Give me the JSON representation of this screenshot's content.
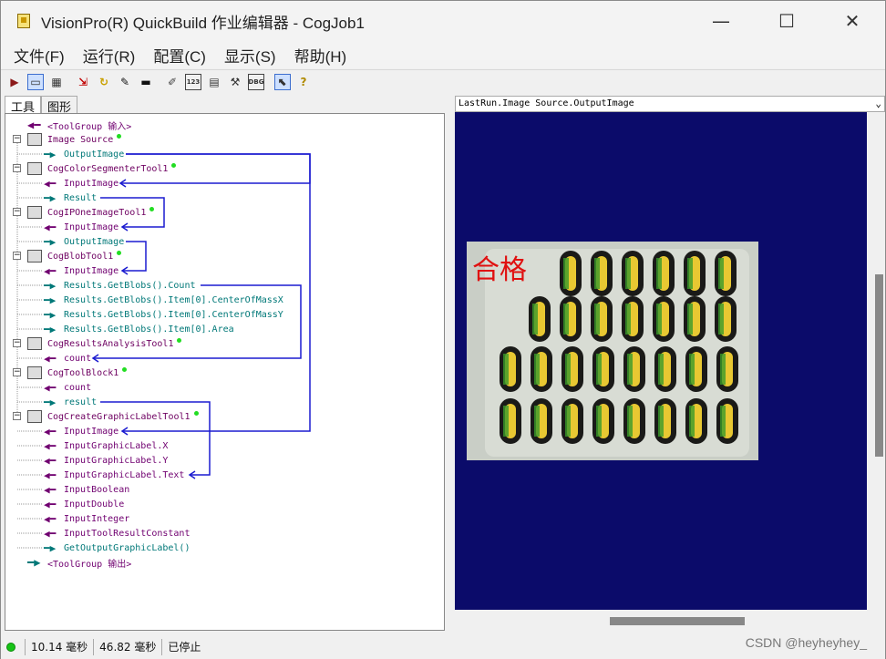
{
  "window": {
    "title": "VisionPro(R) QuickBuild 作业编辑器 - CogJob1",
    "controls": {
      "minimize": "—",
      "maximize": "☐",
      "close": "✕"
    }
  },
  "menu": [
    "文件(F)",
    "运行(R)",
    "配置(C)",
    "显示(S)",
    "帮助(H)"
  ],
  "toolbar": {
    "buttons": [
      {
        "name": "run-icon",
        "glyph": "▶",
        "color": "#8b1a1a"
      },
      {
        "name": "show-tools-icon",
        "glyph": "▭",
        "color": "#333",
        "selected": true
      },
      {
        "name": "show-image-icon",
        "glyph": "▦",
        "color": "#333"
      },
      {
        "name": "add-link-icon",
        "glyph": "⇲",
        "color": "#c00000"
      },
      {
        "name": "refresh-icon",
        "glyph": "↻",
        "color": "#c9a000"
      },
      {
        "name": "brush-icon",
        "glyph": "✎",
        "color": "#111"
      },
      {
        "name": "plug-icon",
        "glyph": "▬",
        "color": "#111"
      },
      {
        "name": "notes-icon",
        "glyph": "✐",
        "color": "#444"
      },
      {
        "name": "numbers-icon",
        "glyph": "123",
        "color": "#333"
      },
      {
        "name": "table-icon",
        "glyph": "▤",
        "color": "#333"
      },
      {
        "name": "tools-icon",
        "glyph": "⚒",
        "color": "#333"
      },
      {
        "name": "debug-icon",
        "glyph": "DBG",
        "color": "#333"
      },
      {
        "name": "pointer-icon",
        "glyph": "⬉",
        "color": "#333",
        "selected": true
      },
      {
        "name": "help-icon",
        "glyph": "?",
        "color": "#b08a00"
      }
    ]
  },
  "tabs": [
    "工具",
    "图形"
  ],
  "tree": {
    "rows": [
      {
        "text": "<ToolGroup 输入>",
        "kind": "group-in"
      },
      {
        "text": "Image Source",
        "kind": "tool",
        "icon": "camera",
        "dot": true
      },
      {
        "text": "OutputImage",
        "kind": "out"
      },
      {
        "text": "CogColorSegmenterTool1",
        "kind": "tool",
        "icon": "color-segmenter",
        "dot": true
      },
      {
        "text": "InputImage",
        "kind": "in"
      },
      {
        "text": "Result",
        "kind": "out"
      },
      {
        "text": "CogIPOneImageTool1",
        "kind": "tool",
        "icon": "ipone",
        "dot": true
      },
      {
        "text": "InputImage",
        "kind": "in"
      },
      {
        "text": "OutputImage",
        "kind": "out"
      },
      {
        "text": "CogBlobTool1",
        "kind": "tool",
        "icon": "blob",
        "dot": true
      },
      {
        "text": "InputImage",
        "kind": "in"
      },
      {
        "text": "Results.GetBlobs().Count",
        "kind": "out"
      },
      {
        "text": "Results.GetBlobs().Item[0].CenterOfMassX",
        "kind": "out"
      },
      {
        "text": "Results.GetBlobs().Item[0].CenterOfMassY",
        "kind": "out"
      },
      {
        "text": "Results.GetBlobs().Item[0].Area",
        "kind": "out"
      },
      {
        "text": "CogResultsAnalysisTool1",
        "kind": "tool",
        "icon": "results-analysis",
        "dot": true
      },
      {
        "text": "count",
        "kind": "in"
      },
      {
        "text": "CogToolBlock1",
        "kind": "tool",
        "icon": "toolblock",
        "dot": true
      },
      {
        "text": "count",
        "kind": "in"
      },
      {
        "text": "result",
        "kind": "out"
      },
      {
        "text": "CogCreateGraphicLabelTool1",
        "kind": "tool",
        "icon": "graphic-label",
        "dot": true
      },
      {
        "text": "InputImage",
        "kind": "in"
      },
      {
        "text": "InputGraphicLabel.X",
        "kind": "in"
      },
      {
        "text": "InputGraphicLabel.Y",
        "kind": "in"
      },
      {
        "text": "InputGraphicLabel.Text",
        "kind": "in"
      },
      {
        "text": "InputBoolean",
        "kind": "in"
      },
      {
        "text": "InputDouble",
        "kind": "in"
      },
      {
        "text": "InputInteger",
        "kind": "in"
      },
      {
        "text": "InputToolResultConstant",
        "kind": "in"
      },
      {
        "text": "GetOutputGraphicLabel()",
        "kind": "out"
      },
      {
        "text": "<ToolGroup 输出>",
        "kind": "group-out"
      }
    ]
  },
  "display": {
    "selector": "LastRun.Image Source.OutputImage",
    "overlay_label": "合格",
    "background": "#0b0b6a"
  },
  "status": {
    "time1": "10.14 毫秒",
    "time2": "46.82 毫秒",
    "state": "已停止"
  },
  "watermark": "CSDN @heyheyhey_"
}
